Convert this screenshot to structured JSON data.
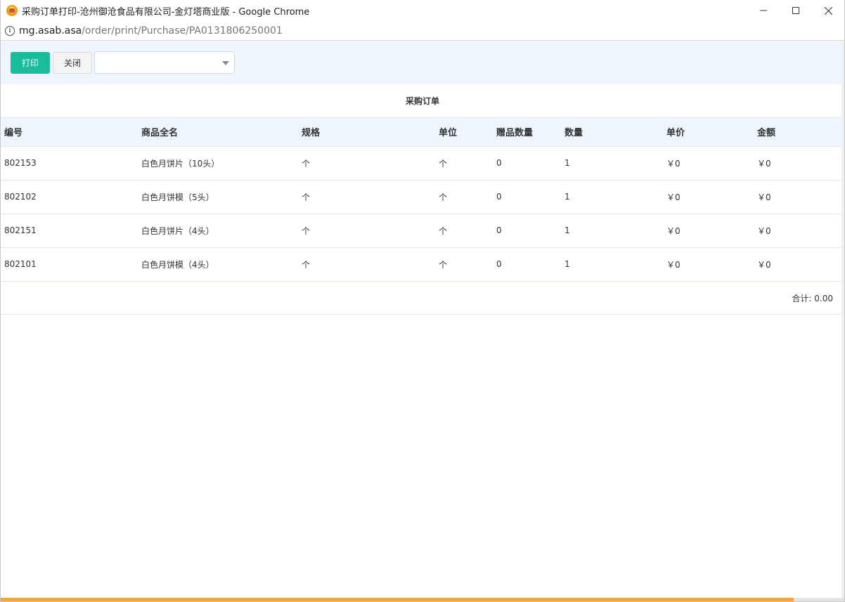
{
  "window": {
    "title": "采购订单打印-沧州御沧食品有限公司-金灯塔商业版 - Google Chrome"
  },
  "address": {
    "host": "mg.asab.asa",
    "path": "/order/print/Purchase/PA0131806250001"
  },
  "toolbar": {
    "print_label": "打印",
    "close_label": "关闭",
    "select_value": ""
  },
  "document": {
    "title": "采购订单",
    "columns": [
      "编号",
      "商品全名",
      "规格",
      "单位",
      "赠品数量",
      "数量",
      "单价",
      "金额"
    ],
    "rows": [
      {
        "code": "802153",
        "name": "白色月饼片（10头）",
        "spec": "个",
        "unit": "个",
        "gift_qty": "0",
        "qty": "1",
        "price": "￥0",
        "amount": "￥0"
      },
      {
        "code": "802102",
        "name": "白色月饼模（5头）",
        "spec": "个",
        "unit": "个",
        "gift_qty": "0",
        "qty": "1",
        "price": "￥0",
        "amount": "￥0"
      },
      {
        "code": "802151",
        "name": "白色月饼片（4头）",
        "spec": "个",
        "unit": "个",
        "gift_qty": "0",
        "qty": "1",
        "price": "￥0",
        "amount": "￥0"
      },
      {
        "code": "802101",
        "name": "白色月饼模（4头）",
        "spec": "个",
        "unit": "个",
        "gift_qty": "0",
        "qty": "1",
        "price": "￥0",
        "amount": "￥0"
      }
    ],
    "total": "合计: 0.00"
  },
  "colors": {
    "print_button": "#1bbc9b",
    "toolbar_bg": "#eef5fd",
    "header_bg": "#eef5fd",
    "progress": "#f0a540"
  },
  "icons": {
    "app": "chrome-app-icon",
    "info": "info-icon",
    "minimize": "minimize-icon",
    "maximize": "maximize-icon",
    "close": "close-icon",
    "dropdown": "chevron-down-icon"
  },
  "progress": {
    "fraction": 0.94
  }
}
